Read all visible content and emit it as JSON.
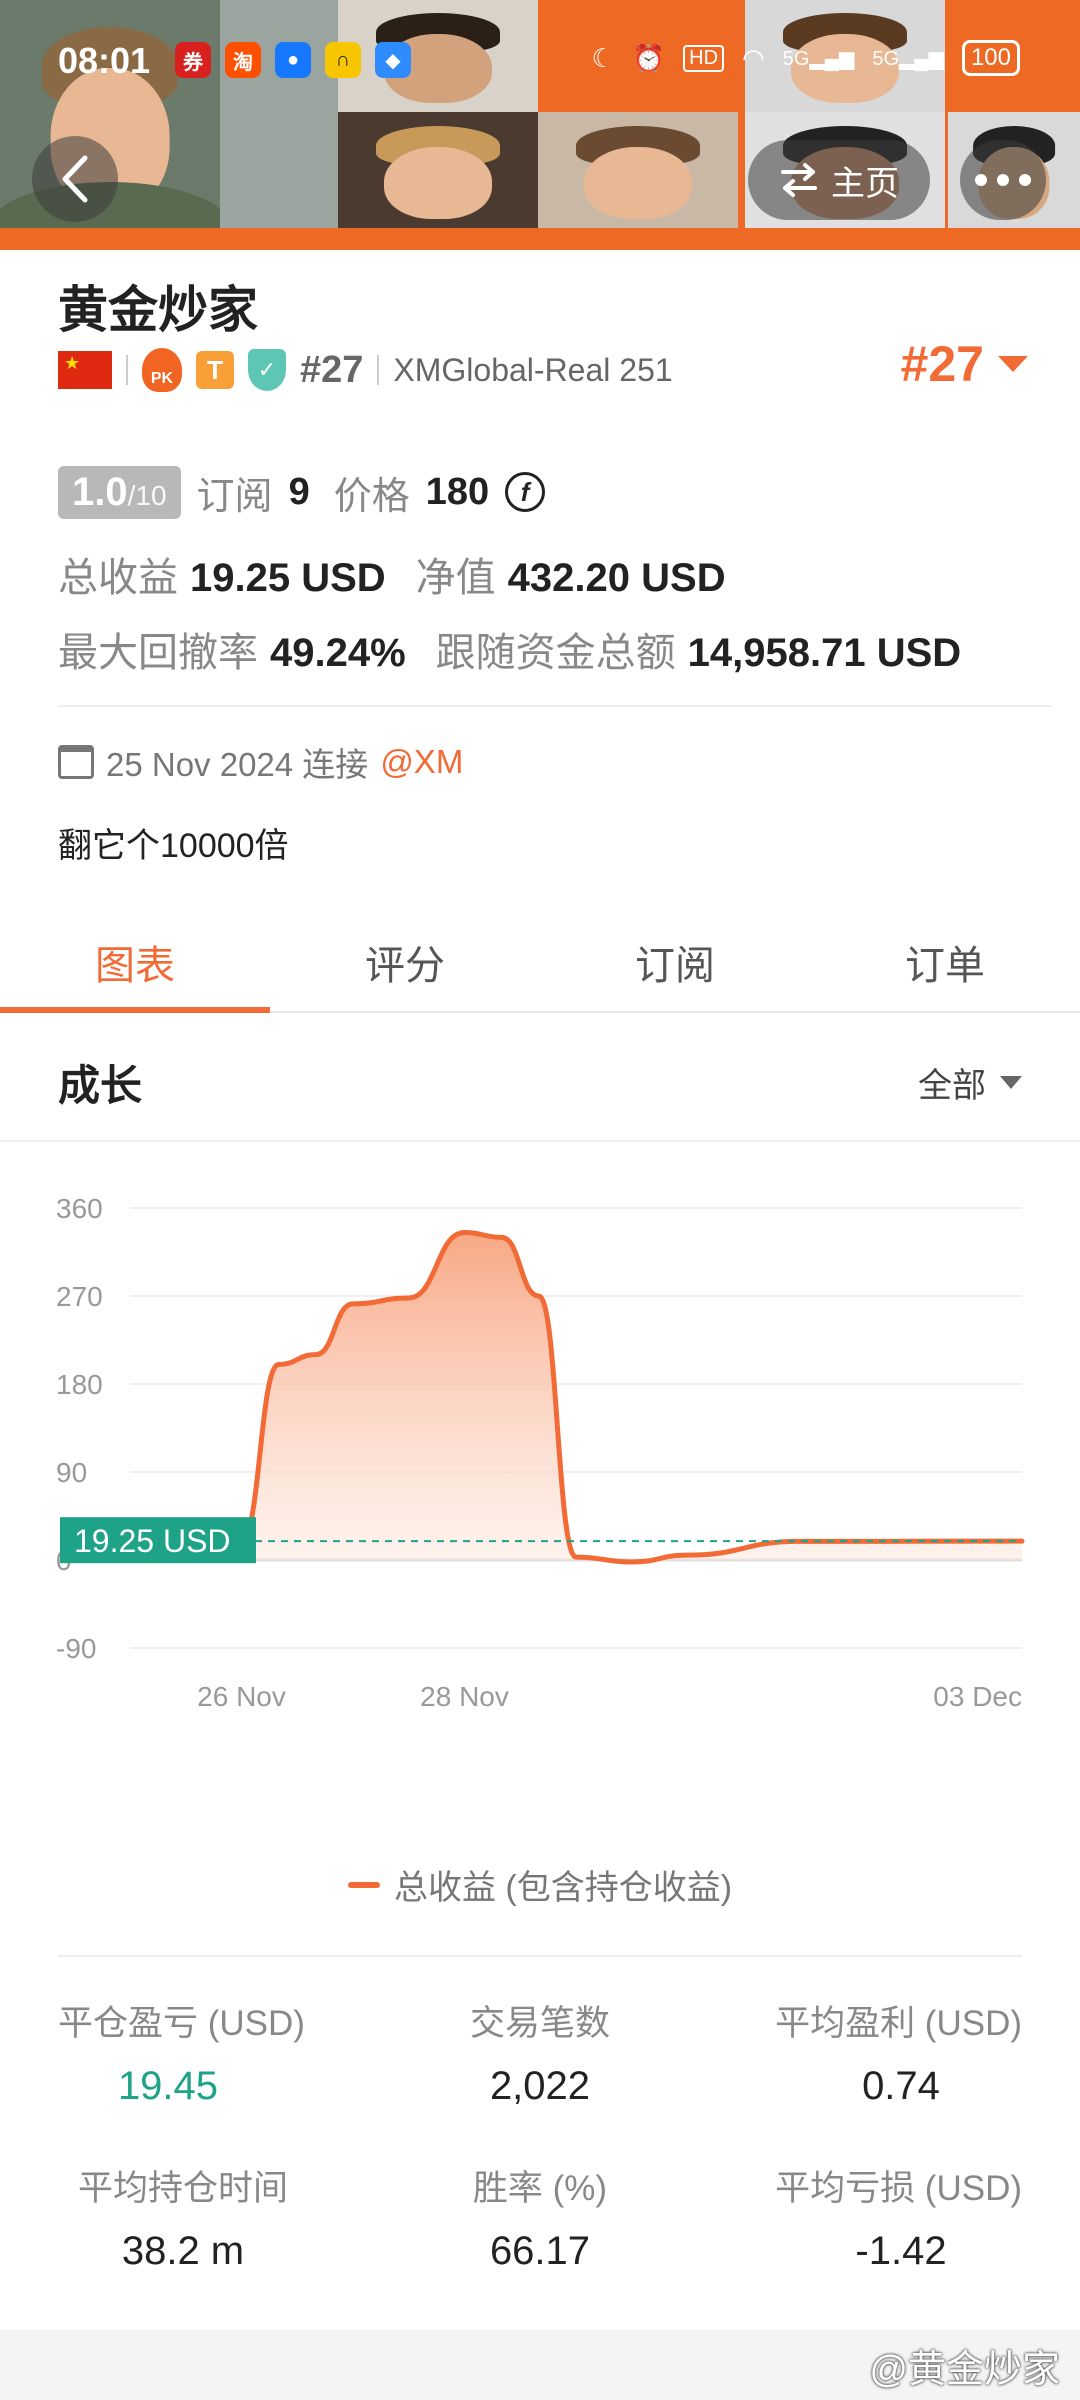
{
  "status_bar": {
    "time": "08:01",
    "battery": "100",
    "hd": "HD",
    "signal1": "5G",
    "signal2": "5G"
  },
  "header": {
    "home_label": "主页"
  },
  "profile": {
    "name": "黄金炒家",
    "rank_small": "#27",
    "broker": "XMGlobal-Real 251",
    "rank_big": "#27",
    "score": "1.0",
    "score_max": "/10",
    "subscribe_label": "订阅",
    "subscribe_count": "9",
    "price_label": "价格",
    "price_value": "180",
    "total_profit_label": "总收益",
    "total_profit_value": "19.25 USD",
    "equity_label": "净值",
    "equity_value": "432.20 USD",
    "max_drawdown_label": "最大回撤率",
    "max_drawdown_value": "49.24%",
    "follow_funds_label": "跟随资金总额",
    "follow_funds_value": "14,958.71 USD",
    "connected_date": "25 Nov 2024 连接",
    "connected_broker": "@XM",
    "motto": "翻它个10000倍"
  },
  "tabs": [
    "图表",
    "评分",
    "订阅",
    "订单"
  ],
  "section": {
    "title": "成长",
    "filter": "全部"
  },
  "chart_data": {
    "type": "area",
    "series": [
      {
        "name": "总收益 (包含持仓收益)",
        "color": "#f26b36"
      }
    ],
    "y_ticks": [
      "360",
      "270",
      "180",
      "90",
      "0",
      "-90"
    ],
    "x_ticks": [
      "26 Nov",
      "28 Nov",
      "03 Dec"
    ],
    "ylim": [
      -90,
      360
    ],
    "x": [
      "25 Nov",
      "25 Nov",
      "26 Nov",
      "26 Nov",
      "26 Nov",
      "27 Nov",
      "27 Nov",
      "28 Nov",
      "28 Nov",
      "28 Nov",
      "29 Nov",
      "29 Nov",
      "30 Nov",
      "01 Dec",
      "03 Dec"
    ],
    "y": [
      0,
      8,
      20,
      200,
      210,
      262,
      268,
      335,
      330,
      270,
      3,
      -2,
      5,
      19,
      19.25
    ],
    "current_label": "19.25 USD",
    "current_value": 19.25,
    "grid": true
  },
  "stats": [
    {
      "label": "平仓盈亏 (USD)",
      "value": "19.45",
      "accent": "#1fa388"
    },
    {
      "label": "交易笔数",
      "value": "2,022"
    },
    {
      "label": "平均盈利 (USD)",
      "value": "0.74"
    },
    {
      "label": "平均持仓时间",
      "value": "38.2 m"
    },
    {
      "label": "胜率 (%)",
      "value": "66.17"
    },
    {
      "label": "平均亏损 (USD)",
      "value": "-1.42"
    }
  ],
  "watermark": "@黄金炒家",
  "colors": {
    "accent": "#f26b36",
    "teal": "#1fa388",
    "header_orange": "#ee6a24"
  }
}
